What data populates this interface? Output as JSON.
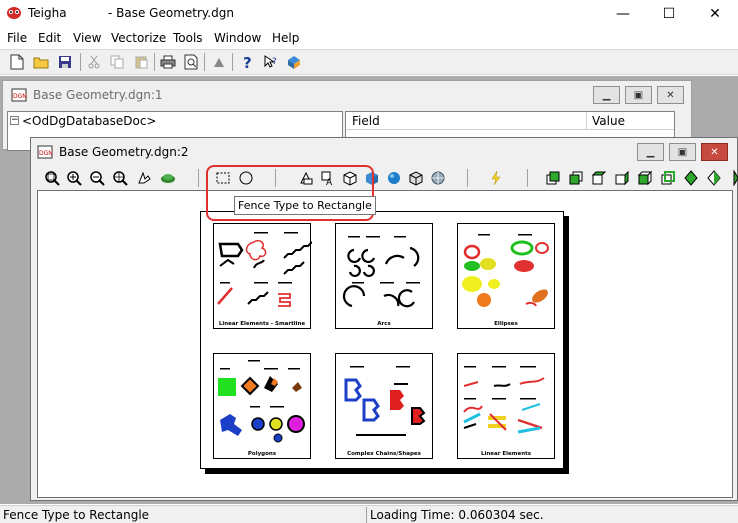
{
  "app": {
    "name": "Teigha",
    "document_title": "- Base Geometry.dgn",
    "minimize": "—",
    "maximize": "☐",
    "close": "✕"
  },
  "menu": {
    "items": [
      "File",
      "Edit",
      "View",
      "Vectorize",
      "Tools",
      "Window",
      "Help"
    ]
  },
  "window1": {
    "title": "Base Geometry.dgn:1",
    "tree_root": "<OdDgDatabaseDoc>",
    "grid_field": "Field",
    "grid_value": "Value"
  },
  "window2": {
    "title": "Base Geometry.dgn:2",
    "tooltip": "Fence Type to Rectangle"
  },
  "drawing": {
    "panels": [
      "Linear Elements - Smartline",
      "Arcs",
      "Ellipses",
      "Polygons",
      "Complex Chains/Shapes",
      "Linear Elements"
    ]
  },
  "status": {
    "left": "Fence Type to Rectangle",
    "right": "Loading Time: 0.060304 sec."
  }
}
